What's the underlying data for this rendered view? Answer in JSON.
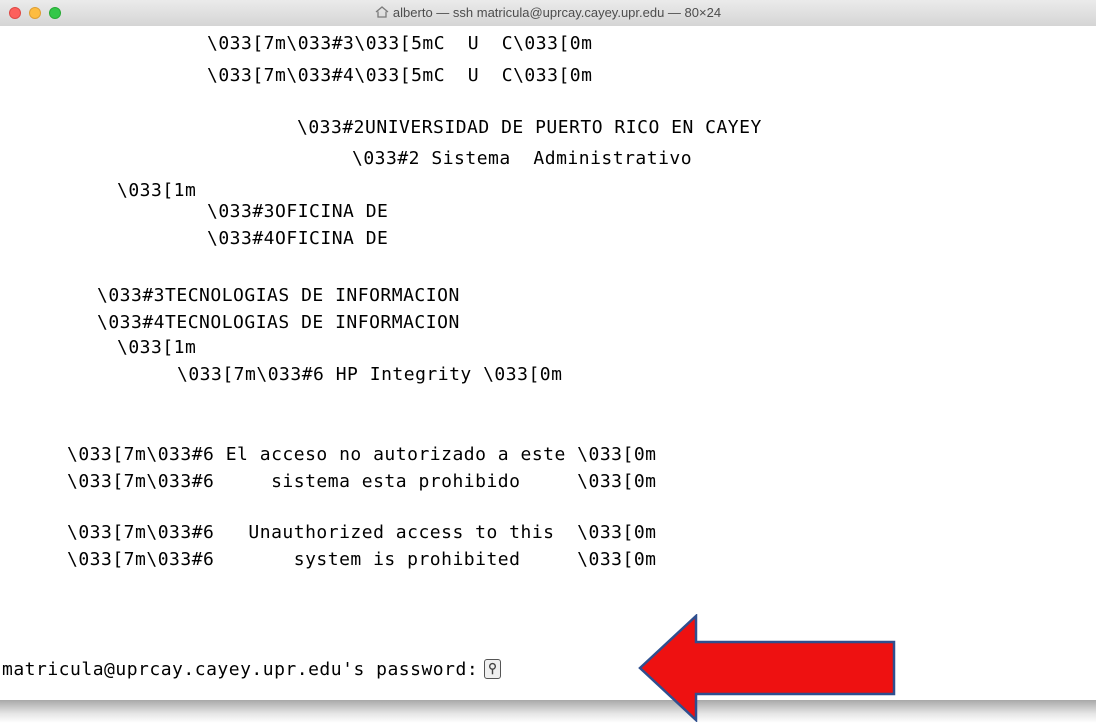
{
  "window": {
    "title": "alberto — ssh matricula@uprcay.cayey.upr.edu — 80×24",
    "title_icon": "home-icon"
  },
  "terminal": {
    "lines": [
      "\\033[7m\\033#3\\033[5mC  U  C\\033[0m",
      "\\033[7m\\033#4\\033[5mC  U  C\\033[0m",
      "\\033#2UNIVERSIDAD DE PUERTO RICO EN CAYEY",
      "\\033#2 Sistema  Administrativo",
      "\\033[1m",
      "\\033#3OFICINA DE",
      "\\033#4OFICINA DE",
      "\\033#3TECNOLOGIAS DE INFORMACION",
      "\\033#4TECNOLOGIAS DE INFORMACION",
      "\\033[1m",
      "\\033[7m\\033#6 HP Integrity \\033[0m",
      "\\033[7m\\033#6 El acceso no autorizado a este \\033[0m",
      "\\033[7m\\033#6     sistema esta prohibido     \\033[0m",
      "\\033[7m\\033#6   Unauthorized access to this  \\033[0m",
      "\\033[7m\\033#6       system is prohibited     \\033[0m"
    ],
    "prompt": "matricula@uprcay.cayey.upr.edu's password:",
    "cursor_icon": "key-icon"
  },
  "annotation": {
    "arrow_color": "#ee1111",
    "arrow_outline": "#2f4f8f"
  }
}
